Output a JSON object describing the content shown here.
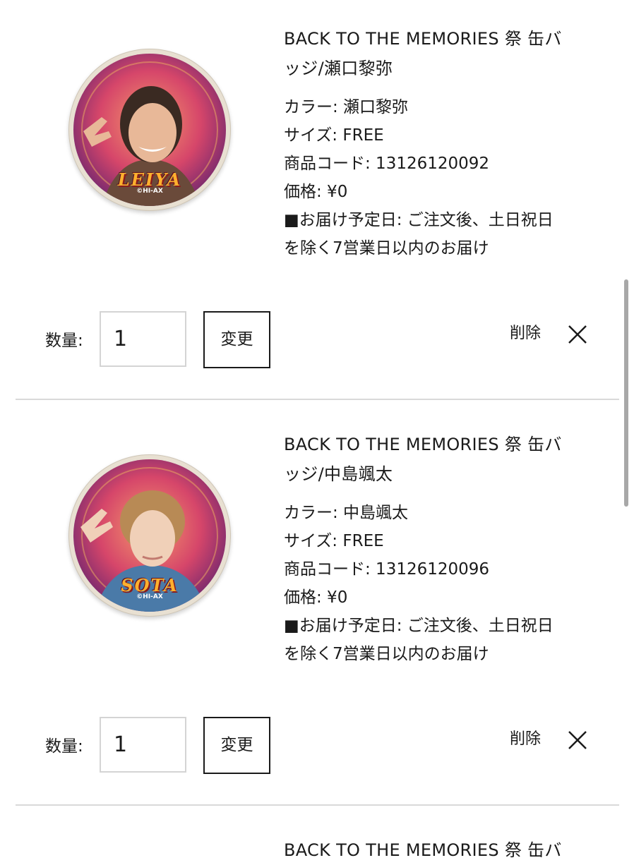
{
  "cart": {
    "quantity_label": "数量:",
    "change_label": "変更",
    "delete_label": "削除",
    "items": [
      {
        "title": "BACK TO THE MEMORIES 祭 缶バッジ/瀬口黎弥",
        "title_line1": "BACK TO THE MEMORIES 祭 缶バ",
        "title_line2": "ッジ/瀬口黎弥",
        "color": "カラー: 瀬口黎弥",
        "size": "サイズ: FREE",
        "code": "商品コード: 13126120092",
        "price": "価格: ¥0",
        "delivery_line1": "■お届け予定日: ご注文後、土日祝日",
        "delivery_line2": "を除く7営業日以内のお届け",
        "quantity": "1",
        "badge_name": "LEIYA",
        "badge_copyright": "©HI-AX",
        "hair_color": "#3a2a22"
      },
      {
        "title": "BACK TO THE MEMORIES 祭 缶バッジ/中島颯太",
        "title_line1": "BACK TO THE MEMORIES 祭 缶バ",
        "title_line2": "ッジ/中島颯太",
        "color": "カラー: 中島颯太",
        "size": "サイズ: FREE",
        "code": "商品コード: 13126120096",
        "price": "価格: ¥0",
        "delivery_line1": "■お届け予定日: ご注文後、土日祝日",
        "delivery_line2": "を除く7営業日以内のお届け",
        "quantity": "1",
        "badge_name": "SOTA",
        "badge_copyright": "©HI-AX",
        "hair_color": "#b88a55"
      }
    ],
    "next_item_partial_title": "BACK TO THE MEMORIES 祭 缶バ"
  }
}
